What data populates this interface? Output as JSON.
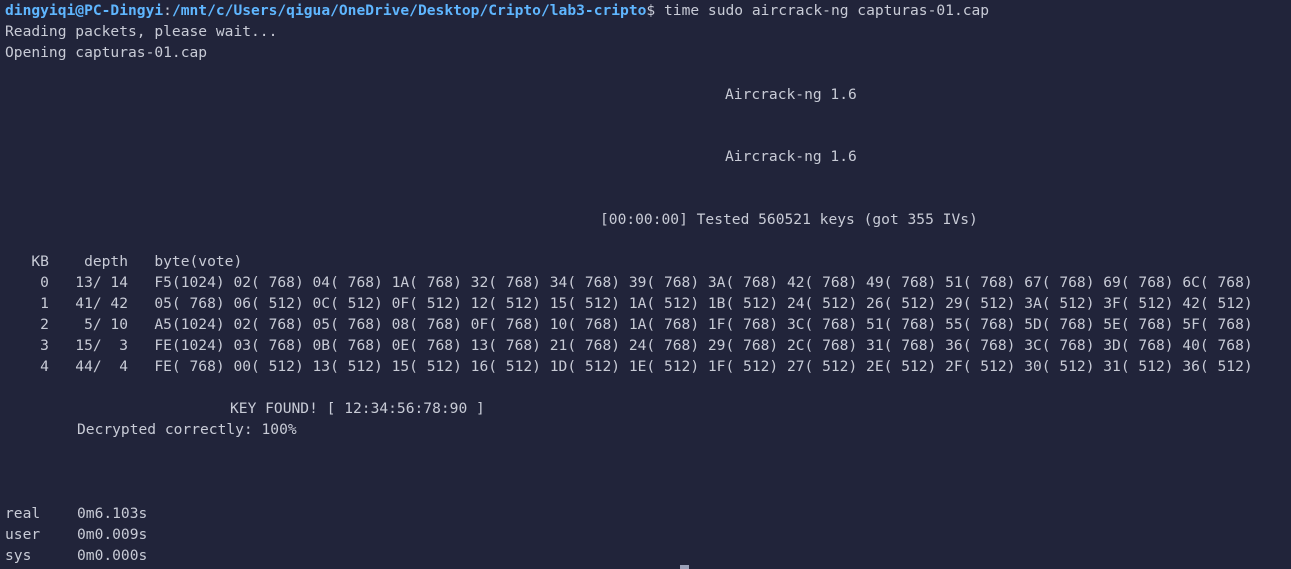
{
  "prompt": {
    "user_host": "dingyiqi@PC-Dingyi",
    "colon": ":",
    "path": "/mnt/c/Users/qigua/OneDrive/Desktop/Cripto/lab3-cripto",
    "dollar": "$",
    "command": " time sudo aircrack-ng capturas-01.cap"
  },
  "output": {
    "reading": "Reading packets, please wait...",
    "opening": "Opening capturas-01.cap",
    "banner1": "Aircrack-ng 1.6",
    "banner2": "Aircrack-ng 1.6",
    "tested": "[00:00:00] Tested 560521 keys (got 355 IVs)",
    "table_header": "   KB    depth   byte(vote)",
    "rows": [
      "    0   13/ 14   F5(1024) 02( 768) 04( 768) 1A( 768) 32( 768) 34( 768) 39( 768) 3A( 768) 42( 768) 49( 768) 51( 768) 67( 768) 69( 768) 6C( 768)",
      "    1   41/ 42   05( 768) 06( 512) 0C( 512) 0F( 512) 12( 512) 15( 512) 1A( 512) 1B( 512) 24( 512) 26( 512) 29( 512) 3A( 512) 3F( 512) 42( 512)",
      "    2    5/ 10   A5(1024) 02( 768) 05( 768) 08( 768) 0F( 768) 10( 768) 1A( 768) 1F( 768) 3C( 768) 51( 768) 55( 768) 5D( 768) 5E( 768) 5F( 768)",
      "    3   15/  3   FE(1024) 03( 768) 0B( 768) 0E( 768) 13( 768) 21( 768) 24( 768) 29( 768) 2C( 768) 31( 768) 36( 768) 3C( 768) 3D( 768) 40( 768)",
      "    4   44/  4   FE( 768) 00( 512) 13( 512) 15( 512) 16( 512) 1D( 512) 1E( 512) 1F( 512) 27( 512) 2E( 512) 2F( 512) 30( 512) 31( 512) 36( 512)"
    ],
    "key_found": "KEY FOUND! [ 12:34:56:78:90 ]",
    "decrypted": "Decrypted correctly: 100%"
  },
  "timing": {
    "real_label": "real",
    "real_value": "0m6.103s",
    "user_label": "user",
    "user_value": "0m0.009s",
    "sys_label": "sys",
    "sys_value": "0m0.000s"
  },
  "colors": {
    "background": "#21243a",
    "text": "#c8cbd6",
    "prompt": "#5fb6ff"
  }
}
